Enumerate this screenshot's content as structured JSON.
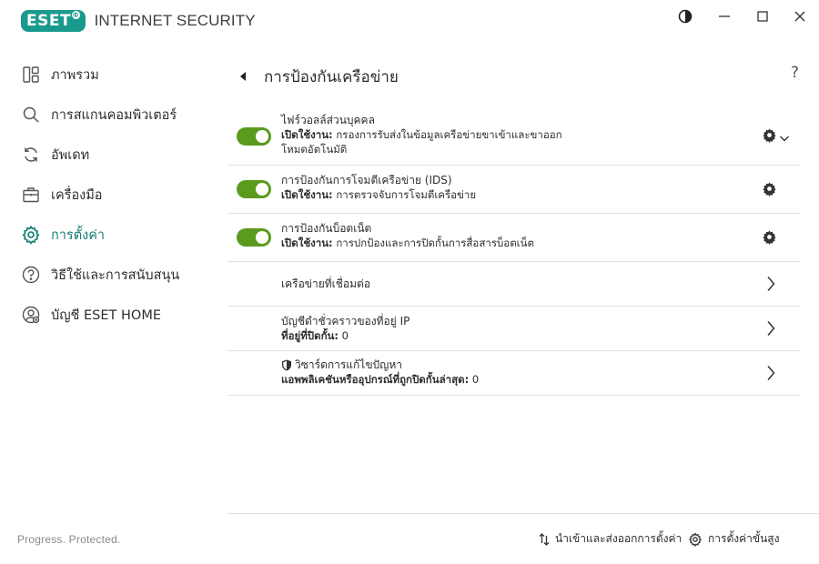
{
  "app": {
    "logo_badge": "eset",
    "product_name": "INTERNET SECURITY",
    "tagline": "Progress. Protected."
  },
  "window_controls": {
    "icons": [
      "contrast-icon",
      "minimize-icon",
      "maximize-icon",
      "close-icon"
    ]
  },
  "sidebar": {
    "items": [
      {
        "label": "ภาพรวม",
        "icon": "overview-icon",
        "active": false
      },
      {
        "label": "การสแกนคอมพิวเตอร์",
        "icon": "search-icon",
        "active": false
      },
      {
        "label": "อัพเดท",
        "icon": "refresh-icon",
        "active": false
      },
      {
        "label": "เครื่องมือ",
        "icon": "briefcase-icon",
        "active": false
      },
      {
        "label": "การตั้งค่า",
        "icon": "gear-icon",
        "active": true
      },
      {
        "label": "วิธีใช้และการสนับสนุน",
        "icon": "help-icon",
        "active": false
      },
      {
        "label": "บัญชี ESET HOME",
        "icon": "account-icon",
        "active": false
      }
    ]
  },
  "main": {
    "title": "การป้องกันเครือข่าย",
    "help": "?",
    "rows": [
      {
        "title": "ไฟร์วอลล์ส่วนบุคคล",
        "status_label": "เปิดใช้งาน:",
        "status_text": "กรองการรับส่งในข้อมูลเครือข่ายขาเข้าและขาออก",
        "extra": "โหมดอัตโนมัติ",
        "enabled": true
      },
      {
        "title": "การป้องกันการโจมตีเครือข่าย (IDS)",
        "status_label": "เปิดใช้งาน:",
        "status_text": "การตรวจจับการโจมตีเครือข่าย",
        "enabled": true
      },
      {
        "title": "การป้องกันบ็อตเน็ต",
        "status_label": "เปิดใช้งาน:",
        "status_text": "การปกป้องและการปิดกั้นการสื่อสารบ็อตเน็ต",
        "enabled": true
      }
    ],
    "links": [
      {
        "title": "เครือข่ายที่เชื่อมต่อ"
      },
      {
        "title": "บัญชีดำชั่วคราวของที่อยู่ IP",
        "sub_label": "ที่อยู่ที่ปิดกั้น:",
        "sub_value": "0"
      },
      {
        "title": "วิซาร์ดการแก้ไขปัญหา",
        "sub_label": "แอพพลิเคชันหรืออุปกรณ์ที่ถูกปิดกั้นล่าสุด:",
        "sub_value": "0",
        "icon": "shield-icon"
      }
    ]
  },
  "footer": {
    "import_export": "นำเข้าและส่งออกการตั้งค่า",
    "advanced": "การตั้งค่าขั้นสูง"
  },
  "colors": {
    "accent": "#127c71",
    "brand": "#1a9a8d",
    "toggle_on": "#5a9a1d"
  }
}
